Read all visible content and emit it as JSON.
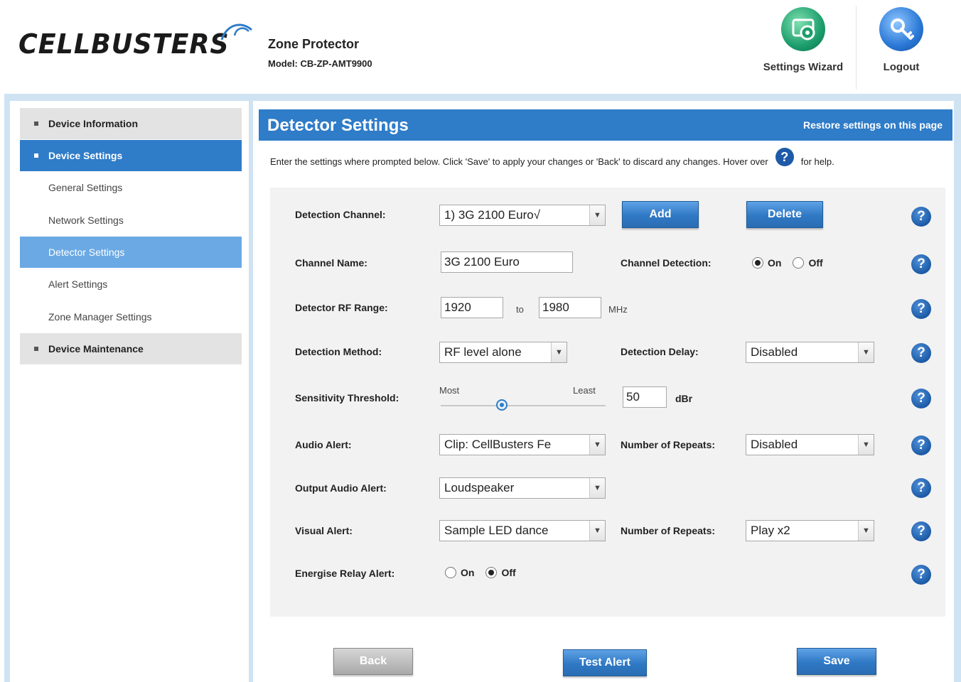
{
  "header": {
    "logo_text": "CELLBUSTERS",
    "product_name": "Zone Protector",
    "model": "Model: CB-ZP-AMT9900",
    "settings_wizard": "Settings Wizard",
    "logout": "Logout"
  },
  "sidebar": {
    "items": [
      {
        "label": "Device Information"
      },
      {
        "label": "Device Settings"
      },
      {
        "label": "General Settings"
      },
      {
        "label": "Network Settings"
      },
      {
        "label": "Detector Settings"
      },
      {
        "label": "Alert Settings"
      },
      {
        "label": "Zone Manager Settings"
      },
      {
        "label": "Device Maintenance"
      }
    ]
  },
  "page": {
    "title": "Detector Settings",
    "restore_link": "Restore settings on this page",
    "intro_before": "Enter the settings where prompted below. Click 'Save' to apply your changes or 'Back' to discard any changes. Hover over",
    "intro_after": "for help.",
    "help_glyph": "?"
  },
  "form": {
    "detection_channel": {
      "label": "Detection Channel:",
      "value": "1) 3G 2100 Euro√",
      "add": "Add",
      "delete": "Delete"
    },
    "channel_name": {
      "label": "Channel Name:",
      "value": "3G 2100 Euro"
    },
    "channel_detection": {
      "label": "Channel Detection:",
      "on": "On",
      "off": "Off",
      "selected": "On"
    },
    "rf_range": {
      "label": "Detector RF Range:",
      "from": "1920",
      "to_label": "to",
      "to": "1980",
      "unit": "MHz"
    },
    "detection_method": {
      "label": "Detection Method:",
      "value": "RF level alone"
    },
    "detection_delay": {
      "label": "Detection Delay:",
      "value": "Disabled"
    },
    "sensitivity": {
      "label": "Sensitivity Threshold:",
      "most": "Most",
      "least": "Least",
      "value": "50",
      "unit": "dBr",
      "slider_position": 0.37
    },
    "audio_alert": {
      "label": "Audio Alert:",
      "value": "Clip: CellBusters Fe"
    },
    "audio_repeats": {
      "label": "Number of Repeats:",
      "value": "Disabled"
    },
    "output_audio_alert": {
      "label": "Output Audio Alert:",
      "value": "Loudspeaker"
    },
    "visual_alert": {
      "label": "Visual Alert:",
      "value": "Sample LED dance"
    },
    "visual_repeats": {
      "label": "Number of Repeats:",
      "value": "Play x2"
    },
    "relay_alert": {
      "label": "Energise Relay Alert:",
      "on": "On",
      "off": "Off",
      "selected": "Off"
    }
  },
  "buttons": {
    "back": "Back",
    "test_alert": "Test Alert",
    "save": "Save"
  },
  "icons": {
    "wizard": "settings-wizard-icon",
    "logout": "logout-key-icon",
    "help": "help-question-icon",
    "dropdown": "chevron-down-icon"
  },
  "colors": {
    "accent": "#2f7cc8",
    "frame": "#cfe3f3",
    "wizard_icon": "#1c9e6c",
    "help_icon": "#1c5aa6"
  }
}
